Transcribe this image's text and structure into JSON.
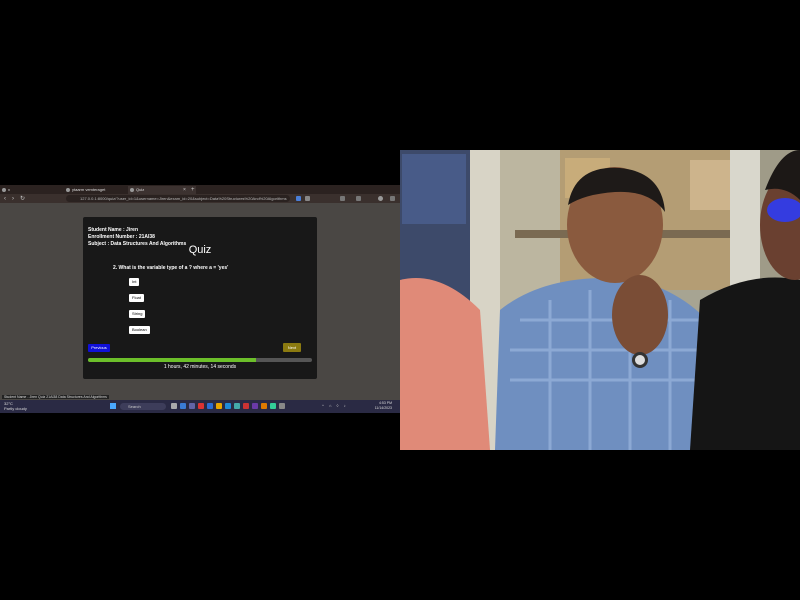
{
  "browser": {
    "tabs": [
      {
        "label": "x"
      },
      {
        "label": "ytaarm vemteraget"
      },
      {
        "label": "Quiz"
      }
    ],
    "tab_close": "×",
    "tab_new": "+",
    "nav": {
      "back": "‹",
      "forward": "›",
      "reload": "↻"
    },
    "url": "127.0.0.1:8000/quiz/?user_id=1&username=Jiren&exam_id=20&subject=Data%20Structures%20And%20Algorithms"
  },
  "quiz": {
    "student_name": "Student Name : Jiren",
    "enrollment": "Enrollment Number : 21AI38",
    "subject": "Subject : Data Structures And Algorithms",
    "title": "Quiz",
    "question": "2. What is the variable type of a ? where a = 'yes'",
    "options": [
      "Int",
      "Float",
      "String",
      "Boolean"
    ],
    "prev_label": "Previous",
    "next_label": "Next",
    "progress": 0.75,
    "timer": "1 hours, 42 minutes, 14 seconds"
  },
  "notification": "Student Name - Jiren Quiz 21AI38 Data Structures And Algorithms",
  "taskbar": {
    "weather": "32°C",
    "weather_sub": "Partly cloudy",
    "search_placeholder": "Search",
    "time": "4:53 PM",
    "date": "11/14/2023"
  },
  "colors": {
    "prev_button": "#1010d8",
    "next_button": "#8b7a10",
    "progress_fill": "#6cbf2a",
    "card_bg": "#181818"
  }
}
